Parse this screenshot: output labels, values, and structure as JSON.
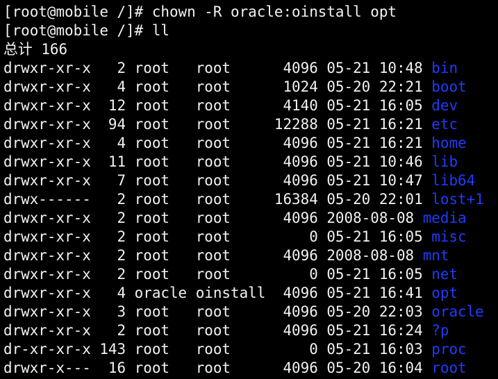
{
  "colors": {
    "background": "#000000",
    "text": "#f2f2f2",
    "directory": "#1e3cff"
  },
  "commands": [
    "[root@mobile /]# chown -R oracle:oinstall opt",
    "[root@mobile /]# ll"
  ],
  "total_line": "总计 166",
  "entries": [
    {
      "meta": "drwxr-xr-x   2 root   root      4096 05-21 10:48 ",
      "name": "bin"
    },
    {
      "meta": "drwxr-xr-x   4 root   root      1024 05-20 22:21 ",
      "name": "boot"
    },
    {
      "meta": "drwxr-xr-x  12 root   root      4140 05-21 16:05 ",
      "name": "dev"
    },
    {
      "meta": "drwxr-xr-x  94 root   root     12288 05-21 16:21 ",
      "name": "etc"
    },
    {
      "meta": "drwxr-xr-x   4 root   root      4096 05-21 16:21 ",
      "name": "home"
    },
    {
      "meta": "drwxr-xr-x  11 root   root      4096 05-21 10:46 ",
      "name": "lib"
    },
    {
      "meta": "drwxr-xr-x   7 root   root      4096 05-21 10:47 ",
      "name": "lib64"
    },
    {
      "meta": "drwx------   2 root   root     16384 05-20 22:01 ",
      "name": "lost+1"
    },
    {
      "meta": "drwxr-xr-x   2 root   root      4096 2008-08-08 ",
      "name": "media"
    },
    {
      "meta": "drwxr-xr-x   2 root   root         0 05-21 16:05 ",
      "name": "misc"
    },
    {
      "meta": "drwxr-xr-x   2 root   root      4096 2008-08-08 ",
      "name": "mnt"
    },
    {
      "meta": "drwxr-xr-x   2 root   root         0 05-21 16:05 ",
      "name": "net"
    },
    {
      "meta": "drwxr-xr-x   4 oracle oinstall  4096 05-21 16:41 ",
      "name": "opt"
    },
    {
      "meta": "drwxr-xr-x   3 root   root      4096 05-20 22:03 ",
      "name": "oracle"
    },
    {
      "meta": "drwxr-xr-x   2 root   root      4096 05-21 16:24 ",
      "name": "?p"
    },
    {
      "meta": "dr-xr-xr-x 143 root   root         0 05-21 16:03 ",
      "name": "proc"
    },
    {
      "meta": "drwxr-x---  16 root   root      4096 05-20 16:04 ",
      "name": "root"
    }
  ]
}
